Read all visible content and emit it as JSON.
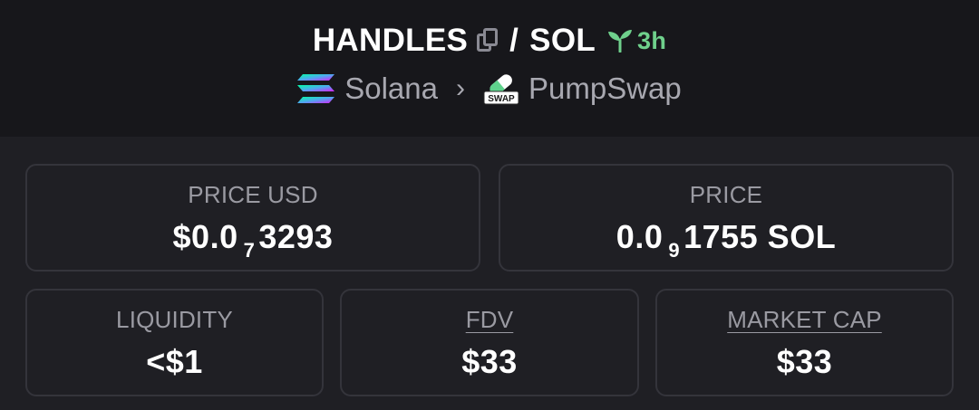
{
  "pair": {
    "base_symbol": "HANDLES",
    "separator": "/",
    "quote_symbol": "SOL",
    "age": "3h"
  },
  "route": {
    "chain": "Solana",
    "dex": "PumpSwap",
    "dex_badge": "SWAP"
  },
  "stats": {
    "price_usd": {
      "label": "PRICE USD",
      "prefix": "$0.0",
      "zeros": "7",
      "digits": "3293"
    },
    "price_native": {
      "label": "PRICE",
      "prefix": "0.0",
      "zeros": "9",
      "digits": "1755 SOL"
    },
    "liquidity": {
      "label": "LIQUIDITY",
      "value": "<$1"
    },
    "fdv": {
      "label": "FDV",
      "value": "$33"
    },
    "market_cap": {
      "label": "MARKET CAP",
      "value": "$33"
    }
  },
  "colors": {
    "background": "#1f1f24",
    "header_bg": "#17171b",
    "card_border": "#34343b",
    "label": "#9a9aa2",
    "age_green": "#6fd08c"
  }
}
